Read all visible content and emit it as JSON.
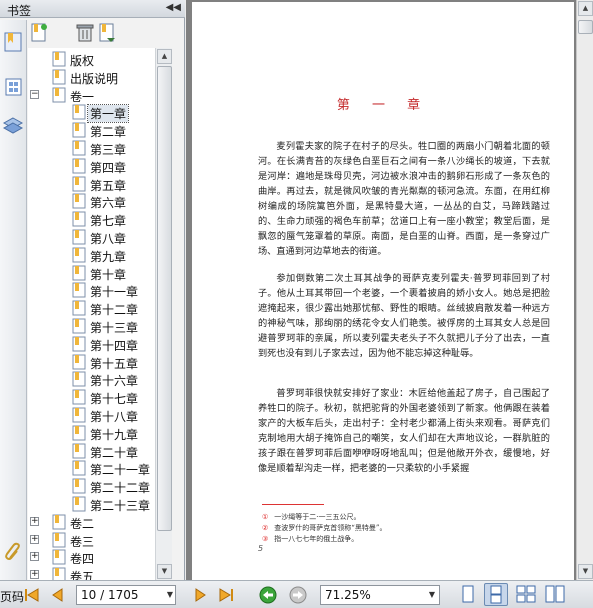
{
  "panel": {
    "title": "书签",
    "collapse_glyph": "◀◀"
  },
  "bookmarks": {
    "top": [
      {
        "label": "版权"
      },
      {
        "label": "出版说明"
      }
    ],
    "volume1": {
      "label": "卷一",
      "expander": "−"
    },
    "chapters": [
      {
        "label": "第一章"
      },
      {
        "label": "第二章"
      },
      {
        "label": "第三章"
      },
      {
        "label": "第四章"
      },
      {
        "label": "第五章"
      },
      {
        "label": "第六章"
      },
      {
        "label": "第七章"
      },
      {
        "label": "第八章"
      },
      {
        "label": "第九章"
      },
      {
        "label": "第十章"
      },
      {
        "label": "第十一章"
      },
      {
        "label": "第十二章"
      },
      {
        "label": "第十三章"
      },
      {
        "label": "第十四章"
      },
      {
        "label": "第十五章"
      },
      {
        "label": "第十六章"
      },
      {
        "label": "第十七章"
      },
      {
        "label": "第十八章"
      },
      {
        "label": "第十九章"
      },
      {
        "label": "第二十章"
      },
      {
        "label": "第二十一章"
      },
      {
        "label": "第二十二章"
      },
      {
        "label": "第二十三章"
      }
    ],
    "selected_chapter": "第一章",
    "volumes_collapsed": [
      {
        "label": "卷二"
      },
      {
        "label": "卷三"
      },
      {
        "label": "卷四"
      },
      {
        "label": "卷五"
      }
    ],
    "collapsed_expander": "+"
  },
  "document": {
    "chapter_title": "第 一 章",
    "p1": "麦列霍夫家的院子在村子的尽头。牲口圈的两扇小门朝着北面的顿河。在长满青苔的灰绿色白垩巨石之间有一条八沙绳长的坡道，下去就是河岸：遍地是珠母贝壳，河边被水浪冲击的鹅卵石形成了一条灰色的曲岸。再过去，就是微风吹皱的青光粼粼的顿河急流。东面，在用红柳树编成的场院篱笆外面，是黑特曼大道，一丛丛的白艾，马蹄践踏过的、生命力顽强的褐色车前草；岔道口上有一座小教堂；教堂后面，是飘忽的蜃气笼罩着的草原。南面，是白垩的山脊。西面，是一条穿过广场、直通到河边草地去的街道。",
    "p2": "参加倒数第二次土耳其战争的哥萨克麦列霍夫·普罗珂菲回到了村子。他从土耳其带回一个老婆，一个裹着披肩的娇小女人。她总是把脸遮掩起来，很少露出她那忧郁、野性的眼睛。丝绒披肩散发着一种远方的神秘气味，那绚丽的绣花令女人们艳羡。被俘房的土耳其女人总是回避普罗珂菲的亲属，所以麦列霍夫老头子不久就把儿子分了出去，一直到死也没有到儿子家去过，因为他不能忘掉这种耻辱。",
    "p3": "普罗珂菲很快就安排好了家业：木匠给他盖起了房子，自己围起了养牲口的院子。秋初，就把驼背的外国老婆领到了新家。他俩跟在装着家产的大板车后头，走出村子：全村老少都涌上街头来观看。哥萨克们克制地用大胡子掩饰自己的嘲笑，女人们却在大声地议论，一群肮脏的孩子跟在普罗珂菲后面咿咿呀呀地乱叫；但是他敞开外衣，缓慢地，好像是顺着犁沟走一样，把老婆的一只柔软的小手紧握",
    "footnotes": [
      {
        "num": "①",
        "text": "一沙绳等于二·一三五公尺。"
      },
      {
        "num": "②",
        "text": "查波罗什的哥萨克首领称“黑特曼”。"
      },
      {
        "num": "③",
        "text": "指一八七七年的俄土战争。"
      }
    ],
    "page_mark": "5"
  },
  "navbar": {
    "label": "页码:",
    "page_value": "10 / 1705",
    "zoom_value": "71.25%",
    "dropdown_glyph": "▼"
  }
}
